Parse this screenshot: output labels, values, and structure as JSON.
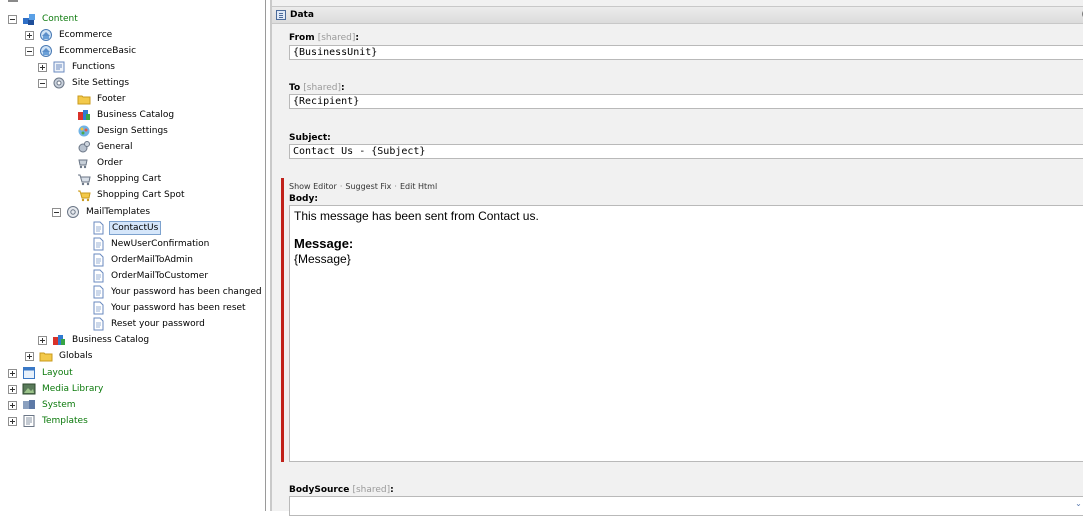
{
  "tree": {
    "items": [
      {
        "label": "Content",
        "toggle": "minus",
        "icon": "content-icon",
        "green": true
      },
      {
        "label": "Ecommerce",
        "toggle": "plus",
        "icon": "site-icon"
      },
      {
        "label": "EcommerceBasic",
        "toggle": "minus",
        "icon": "site-icon"
      },
      {
        "label": "Functions",
        "toggle": "plus",
        "icon": "functions-icon"
      },
      {
        "label": "Site Settings",
        "toggle": "minus",
        "icon": "settings-gear-icon"
      },
      {
        "label": "Footer",
        "toggle": "none",
        "icon": "folder-icon"
      },
      {
        "label": "Business Catalog",
        "toggle": "none",
        "icon": "business-catalog-icon"
      },
      {
        "label": "Design Settings",
        "toggle": "none",
        "icon": "design-settings-icon"
      },
      {
        "label": "General",
        "toggle": "none",
        "icon": "general-settings-icon"
      },
      {
        "label": "Order",
        "toggle": "none",
        "icon": "order-icon"
      },
      {
        "label": "Shopping Cart",
        "toggle": "none",
        "icon": "shopping-cart-icon"
      },
      {
        "label": "Shopping Cart Spot",
        "toggle": "none",
        "icon": "shopping-cart-spot-icon"
      },
      {
        "label": "MailTemplates",
        "toggle": "minus",
        "icon": "mail-templates-icon"
      },
      {
        "label": "ContactUs",
        "toggle": "none",
        "icon": "document-icon",
        "selected": true
      },
      {
        "label": "NewUserConfirmation",
        "toggle": "none",
        "icon": "document-icon"
      },
      {
        "label": "OrderMailToAdmin",
        "toggle": "none",
        "icon": "document-icon"
      },
      {
        "label": "OrderMailToCustomer",
        "toggle": "none",
        "icon": "document-icon"
      },
      {
        "label": "Your password has been changed",
        "toggle": "none",
        "icon": "document-icon"
      },
      {
        "label": "Your password has been reset",
        "toggle": "none",
        "icon": "document-icon"
      },
      {
        "label": "Reset your password",
        "toggle": "none",
        "icon": "document-icon"
      },
      {
        "label": "Business Catalog",
        "toggle": "plus",
        "icon": "business-catalog-icon"
      },
      {
        "label": "Globals",
        "toggle": "plus",
        "icon": "folder-icon"
      },
      {
        "label": "Layout",
        "toggle": "plus",
        "icon": "layout-icon",
        "green": true
      },
      {
        "label": "Media Library",
        "toggle": "plus",
        "icon": "media-library-icon",
        "green": true
      },
      {
        "label": "System",
        "toggle": "plus",
        "icon": "system-icon",
        "green": true
      },
      {
        "label": "Templates",
        "toggle": "plus",
        "icon": "templates-icon",
        "green": true
      }
    ]
  },
  "editor": {
    "section_title": "Data",
    "section_right": "(",
    "from": {
      "label": "From",
      "shared": "[shared]",
      "colon": ":",
      "value": "{BusinessUnit}"
    },
    "to": {
      "label": "To",
      "shared": "[shared]",
      "colon": ":",
      "value": "{Recipient}"
    },
    "subject": {
      "label": "Subject:",
      "value": "Contact Us - {Subject}"
    },
    "body_tools": {
      "show_editor": "Show Editor",
      "suggest_fix": "Suggest Fix",
      "edit_html": "Edit Html",
      "separator": "·"
    },
    "body": {
      "label": "Body:",
      "line1": "This message has been sent from Contact us.",
      "heading": "Message:",
      "message": "{Message}"
    },
    "bodysource": {
      "label": "BodySource",
      "shared": "[shared]",
      "colon": ":"
    }
  },
  "colors": {
    "green_label": "#0c7a0c",
    "required_bar": "#c0221b",
    "selection": "#d5e6fa"
  }
}
